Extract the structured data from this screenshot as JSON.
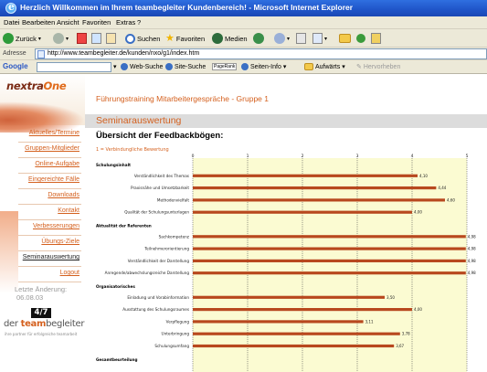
{
  "window": {
    "title": "Herzlich Willkommen im Ihrem teambegleiter Kundenbereich! - Microsoft Internet Explorer"
  },
  "menu": [
    "Datei",
    "Bearbeiten",
    "Ansicht",
    "Favoriten",
    "Extras",
    "?"
  ],
  "toolbar": {
    "back": "Zurück",
    "search": "Suchen",
    "favorites": "Favoriten",
    "media": "Medien"
  },
  "address": {
    "label": "Adresse",
    "url": "http://www.teambegleiter.de/kunden/nxo/g1/index.htm"
  },
  "googlebar": {
    "logo": "Google",
    "web_search": "Web-Suche",
    "site_search": "Site-Suche",
    "pagerank": "PageRank",
    "page_info": "Seiten-Info",
    "up": "Aufwärts",
    "highlight": "Hervorheben"
  },
  "sidebar": {
    "logo_a": "nextra",
    "logo_b": "One",
    "items": [
      {
        "label": "Aktuelles/Termine",
        "active": false
      },
      {
        "label": "Gruppen-Mitglieder",
        "active": false
      },
      {
        "label": "Online-Aufgabe",
        "active": false
      },
      {
        "label": "Eingereichte Fälle",
        "active": false
      },
      {
        "label": "Downloads",
        "active": false
      },
      {
        "label": "Kontakt",
        "active": false
      },
      {
        "label": "Verbesserungen",
        "active": false
      },
      {
        "label": "Übungs-Ziele",
        "active": false
      },
      {
        "label": "Seminarauswertung",
        "active": true
      },
      {
        "label": "Logout",
        "active": false
      }
    ],
    "last_change_label": "Letzte Änderung:",
    "last_change_date": "06.08.03",
    "badge": "4/7",
    "brand_a": "der ",
    "brand_b": "team",
    "brand_c": "begleiter",
    "brand_sub": "ihre partner für erfolgreiche teamarbeit"
  },
  "content": {
    "page_title": "Führungstraining Mitarbeitergespräche - Gruppe 1",
    "section_title": "Seminarauswertung",
    "subheading": "Übersicht der Feedbackbögen:",
    "legend_label": "1 = Verbindungliche Bewertung"
  },
  "colors": {
    "accent": "#d4601e",
    "bar": "#b8481e",
    "plot_bg": "#fbfbd2"
  },
  "chart_data": {
    "type": "bar",
    "orientation": "horizontal",
    "xlim": [
      0,
      5
    ],
    "ticks": [
      0,
      1,
      2,
      3,
      4,
      5
    ],
    "groups": [
      {
        "name": "Schulungsinhalt",
        "items": [
          {
            "label": "Verständlichkeit des Themas",
            "value": 4.1,
            "value_label": "4,10"
          },
          {
            "label": "Praxisnähe und Umsetzbarkeit",
            "value": 4.44,
            "value_label": "4,44"
          },
          {
            "label": "Methodenvielfalt",
            "value": 4.6,
            "value_label": "4,60"
          },
          {
            "label": "Qualität der Schulungsunterlagen",
            "value": 4.0,
            "value_label": "4,00"
          }
        ]
      },
      {
        "name": "Aktualität der Referenten",
        "items": [
          {
            "label": "Sachkompetenz",
            "value": 4.98,
            "value_label": "4,98"
          },
          {
            "label": "Teilnehmerorientierung",
            "value": 4.98,
            "value_label": "4,98"
          },
          {
            "label": "Verständlichkeit der Darstellung",
            "value": 4.98,
            "value_label": "4,98"
          },
          {
            "label": "Anregende/abwechslungsreiche Darstellung",
            "value": 4.98,
            "value_label": "4,98"
          }
        ]
      },
      {
        "name": "Organisatorisches",
        "items": [
          {
            "label": "Einladung und Vorabinformation",
            "value": 3.5,
            "value_label": "3,50"
          },
          {
            "label": "Ausstattung des Schulungsraumes",
            "value": 4.0,
            "value_label": "4,00"
          },
          {
            "label": "Verpflegung",
            "value": 3.11,
            "value_label": "3,11"
          },
          {
            "label": "Unterbringung",
            "value": 3.78,
            "value_label": "3,78"
          },
          {
            "label": "Schulungsumfang",
            "value": 3.67,
            "value_label": "3,67"
          }
        ]
      },
      {
        "name": "Gesamtbeurteilung",
        "items": []
      }
    ]
  }
}
